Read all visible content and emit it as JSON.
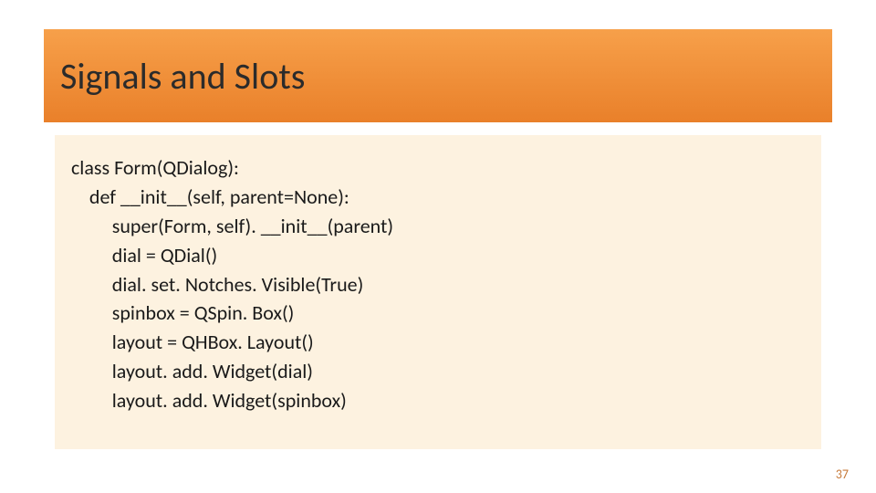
{
  "header": {
    "title": "Signals and Slots"
  },
  "code": {
    "lines": [
      "class Form(QDialog):",
      "    def __init__(self, parent=None):",
      "         super(Form, self). __init__(parent)",
      "         dial = QDial()",
      "         dial. set. Notches. Visible(True)",
      "         spinbox = QSpin. Box()",
      "         layout = QHBox. Layout()",
      "         layout. add. Widget(dial)",
      "         layout. add. Widget(spinbox)"
    ]
  },
  "page_number": "37"
}
